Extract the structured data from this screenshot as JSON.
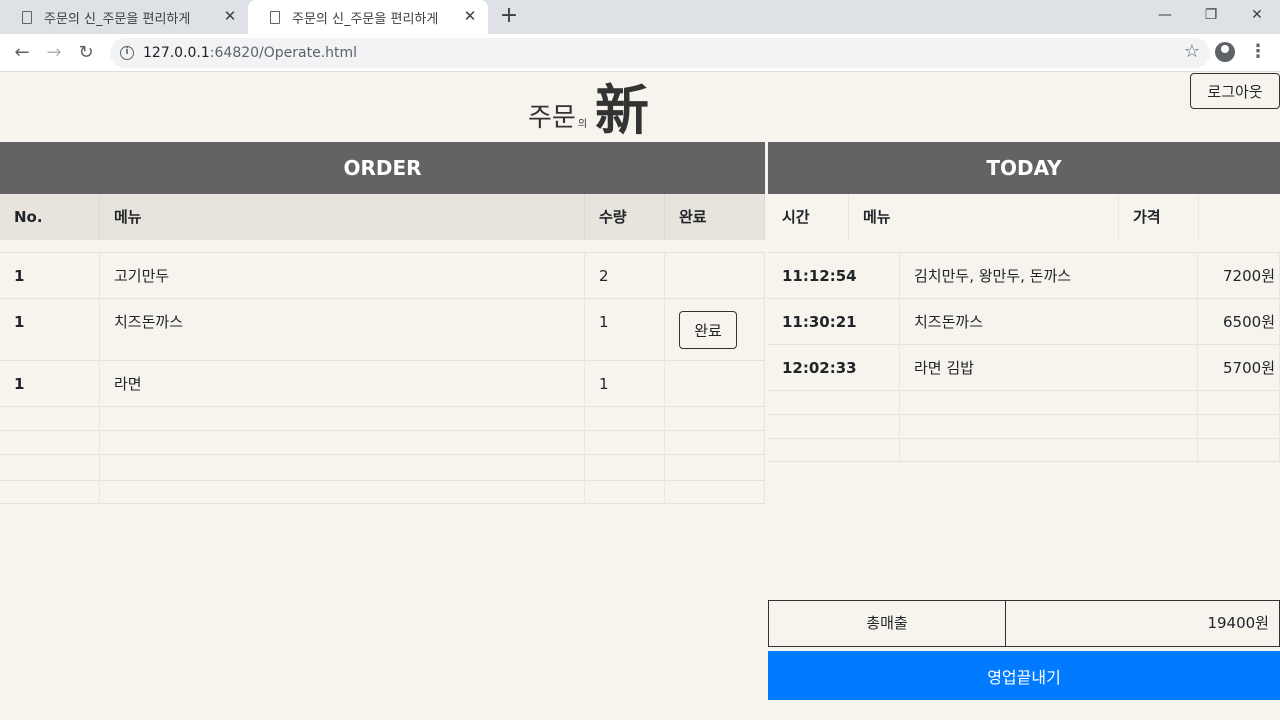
{
  "browser": {
    "tabs": [
      {
        "title": "주문의 신_주문을 편리하게"
      },
      {
        "title": "주문의 신_주문을 편리하게"
      }
    ],
    "url_host": "127.0.0.1",
    "url_rest": ":64820/Operate.html"
  },
  "logo": {
    "main": "주문",
    "particle": "의",
    "hanja": "新"
  },
  "logout_label": "로그아웃",
  "order": {
    "header": "ORDER",
    "columns": [
      "No.",
      "메뉴",
      "수량",
      "완료"
    ],
    "rows": [
      {
        "no": "1",
        "menu": "고기만두",
        "qty": "2"
      },
      {
        "no": "1",
        "menu": "치즈돈까스",
        "qty": "1",
        "button": "완료"
      },
      {
        "no": "1",
        "menu": "라면",
        "qty": "1"
      }
    ]
  },
  "today": {
    "header": "TODAY",
    "columns": [
      "시간",
      "메뉴",
      "가격"
    ],
    "rows": [
      {
        "time": "11:12:54",
        "menu": "김치만두, 왕만두, 돈까스",
        "price": "7200원"
      },
      {
        "time": "11:30:21",
        "menu": "치즈돈까스",
        "price": "6500원"
      },
      {
        "time": "12:02:33",
        "menu": "라면 김밥",
        "price": "5700원"
      }
    ]
  },
  "total": {
    "label": "총매출",
    "value": "19400원"
  },
  "close_business_label": "영업끝내기"
}
